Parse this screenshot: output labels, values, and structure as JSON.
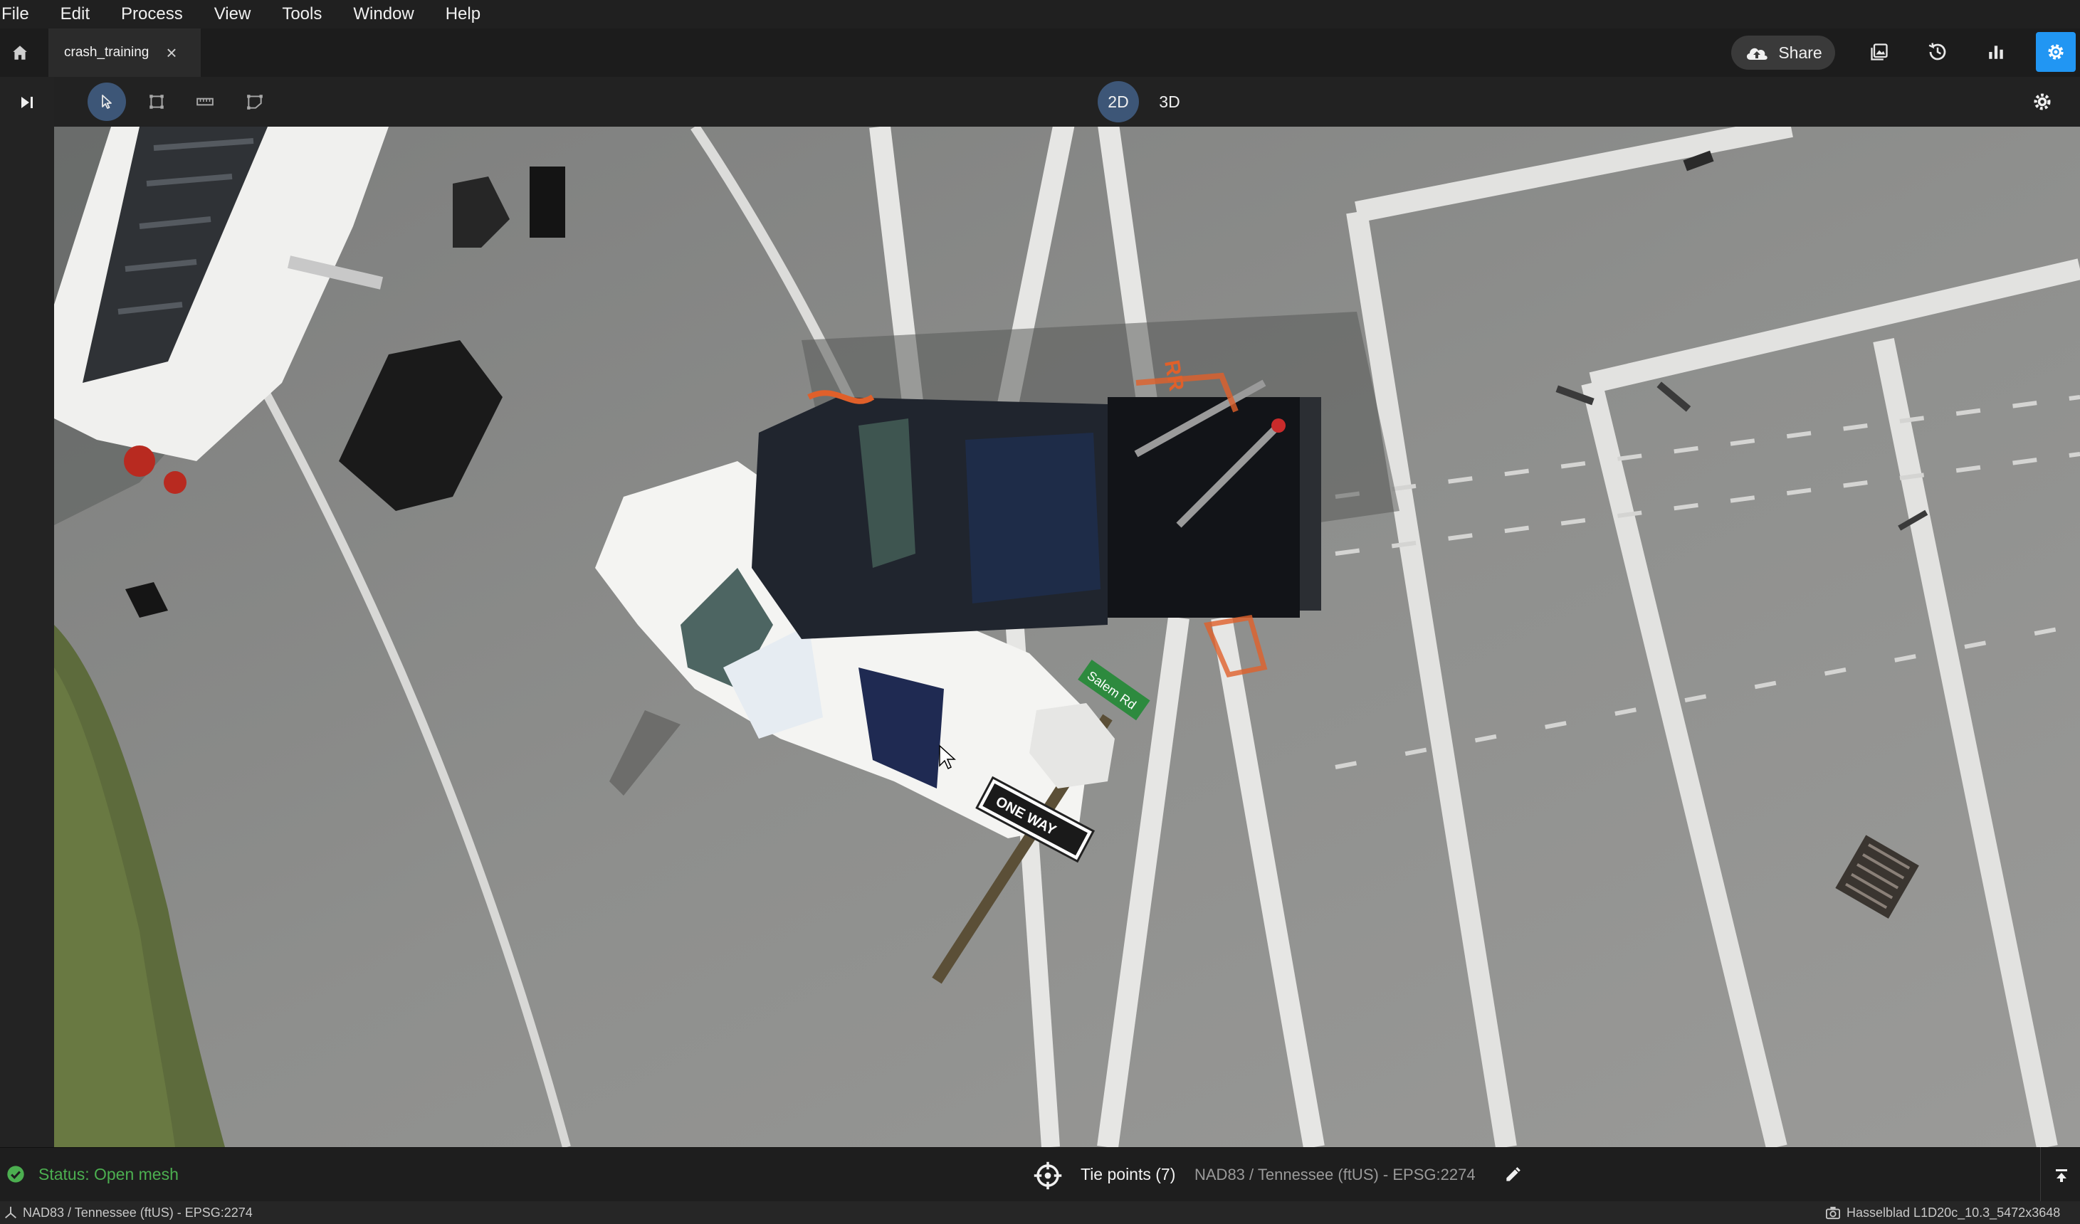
{
  "menu": [
    "File",
    "Edit",
    "Process",
    "View",
    "Tools",
    "Window",
    "Help"
  ],
  "tab": {
    "label": "crash_training",
    "close_glyph": "×"
  },
  "header": {
    "share_label": "Share"
  },
  "view_modes": {
    "mode_2d": "2D",
    "mode_3d": "3D",
    "selected": "2D"
  },
  "sign_labels": {
    "one_way": "ONE WAY",
    "street": "Salem Rd",
    "paint_marker": "RR"
  },
  "status": {
    "text": "Status: Open mesh"
  },
  "tie_points": {
    "label": "Tie points (7)",
    "crs": "NAD83 / Tennessee (ftUS) - EPSG:2274"
  },
  "footer": {
    "crs": "NAD83 / Tennessee (ftUS) - EPSG:2274",
    "camera": "Hasselblad L1D20c_10.3_5472x3648"
  },
  "colors": {
    "accent": "#2196f3",
    "status_ok": "#4caf50",
    "active_tool": "#3d5677"
  },
  "icons": [
    "home-icon",
    "close-icon",
    "cloud-upload-icon",
    "image-icon",
    "history-icon",
    "bar-chart-icon",
    "gear-icon",
    "skip-forward-icon",
    "cursor-icon",
    "rectangle-select-icon",
    "measure-icon",
    "polygon-icon",
    "crosshair-icon",
    "pencil-icon",
    "check-circle-icon",
    "collapse-icon",
    "camera-icon",
    "axis-icon"
  ]
}
